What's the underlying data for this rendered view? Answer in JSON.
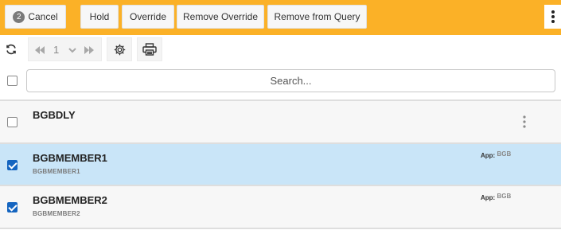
{
  "action_bar": {
    "selected_count": "2",
    "cancel_label": "Cancel",
    "hold_label": "Hold",
    "override_label": "Override",
    "remove_override_label": "Remove Override",
    "remove_from_query_label": "Remove from Query",
    "more_icon": "more-vertical-icon",
    "background_color": "#fbb127"
  },
  "toolbar": {
    "refresh_icon": "refresh-icon",
    "first_page_icon": "first-page-icon",
    "page_number": "1",
    "page_dropdown_icon": "chevron-down-icon",
    "last_page_icon": "last-page-icon",
    "settings_icon": "gear-icon",
    "print_icon": "print-icon"
  },
  "search": {
    "placeholder": "Search...",
    "value": ""
  },
  "list": {
    "selected_row_color": "#c9e5f8",
    "checkbox_checked_color": "#1565c0",
    "items": [
      {
        "title": "BGBDLY",
        "subtitle": "",
        "app_label": "",
        "app_value": "",
        "checked": false
      },
      {
        "title": "BGBMEMBER1",
        "subtitle": "BGBMEMBER1",
        "app_label": "App:",
        "app_value": "BGB",
        "checked": true
      },
      {
        "title": "BGBMEMBER2",
        "subtitle": "BGBMEMBER2",
        "app_label": "App:",
        "app_value": "BGB",
        "checked": true
      }
    ]
  }
}
